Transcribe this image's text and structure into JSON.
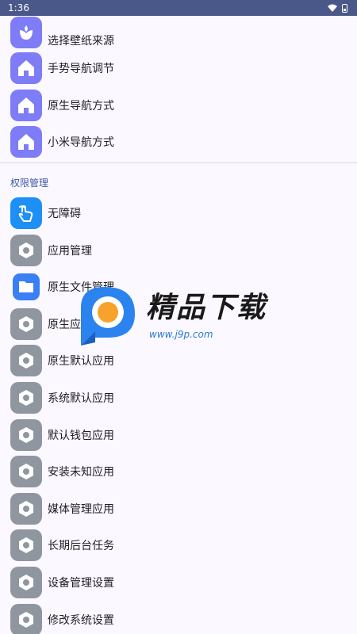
{
  "status_bar": {
    "time": "1:36"
  },
  "top_items": [
    {
      "label": "选择壁纸来源",
      "icon": "tulip-icon"
    },
    {
      "label": "手势导航调节",
      "icon": "home-icon"
    },
    {
      "label": "原生导航方式",
      "icon": "home-icon"
    },
    {
      "label": "小米导航方式",
      "icon": "home-icon"
    }
  ],
  "permissions": {
    "section_title": "权限管理",
    "items": [
      {
        "label": "无障碍",
        "icon": "hand-touch-icon"
      },
      {
        "label": "应用管理",
        "icon": "hexagon-icon"
      },
      {
        "label": "原生文件管理",
        "icon": "folder-icon"
      },
      {
        "label": "原生应用管理",
        "icon": "hexagon-icon"
      },
      {
        "label": "原生默认应用",
        "icon": "hexagon-icon"
      },
      {
        "label": "系统默认应用",
        "icon": "hexagon-icon"
      },
      {
        "label": "默认钱包应用",
        "icon": "hexagon-icon"
      },
      {
        "label": "安装未知应用",
        "icon": "hexagon-icon"
      },
      {
        "label": "媒体管理应用",
        "icon": "hexagon-icon"
      },
      {
        "label": "长期后台任务",
        "icon": "hexagon-icon"
      },
      {
        "label": "设备管理设置",
        "icon": "hexagon-icon"
      },
      {
        "label": "修改系统设置",
        "icon": "hexagon-icon"
      }
    ]
  },
  "watermark": {
    "title": "精品下载",
    "url": "www.j9p.com"
  },
  "colors": {
    "status_bar": "#4a5889",
    "accent_purple": "#7e7cf6",
    "accent_blue": "#1e8ff4",
    "neutral_gray": "#8f96a0",
    "section_title": "#3d5aa8"
  }
}
